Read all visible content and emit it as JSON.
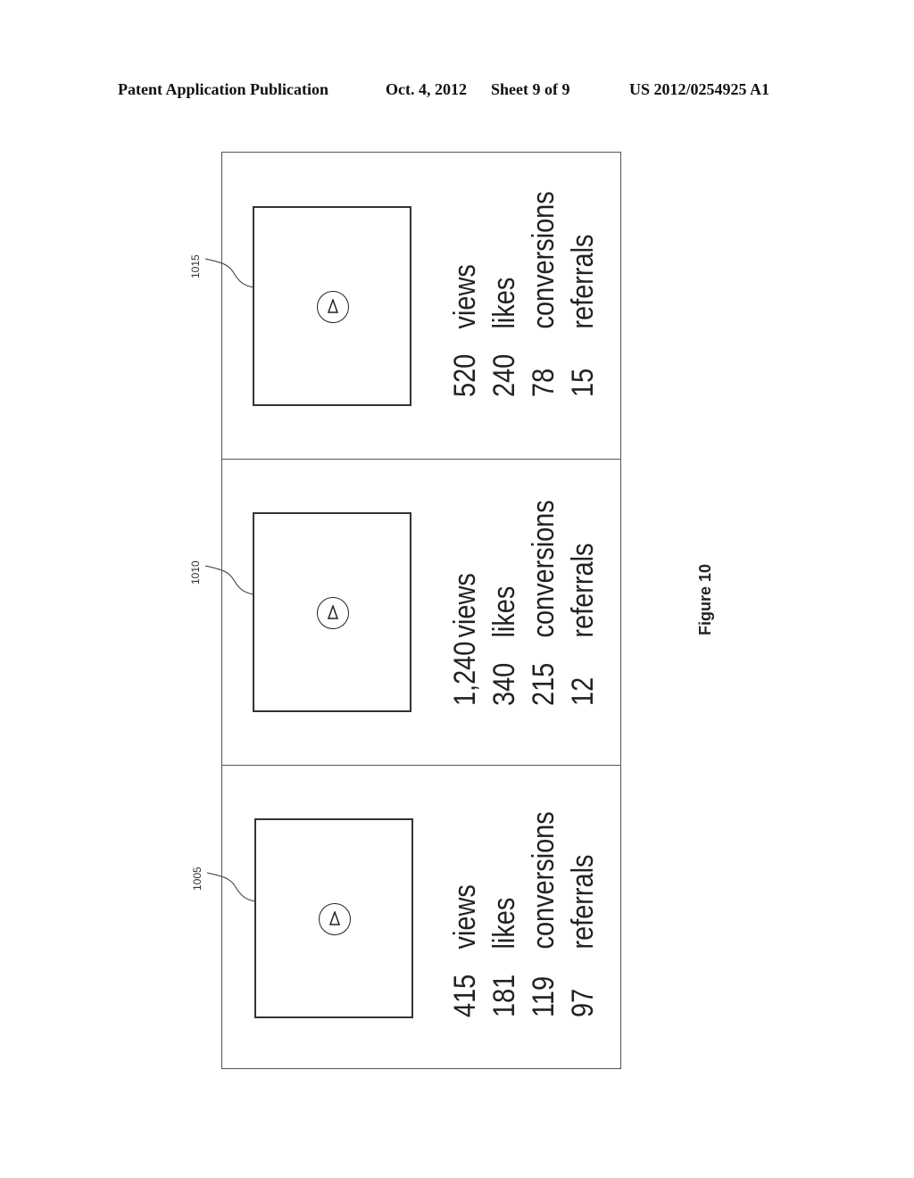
{
  "header": {
    "publication": "Patent Application Publication",
    "date": "Oct. 4, 2012",
    "sheet": "Sheet 9 of 9",
    "patent_number": "US 2012/0254925 A1"
  },
  "figure": {
    "label": "Figure 10",
    "panels": [
      {
        "ref": "1015",
        "icon": "play-icon",
        "stats": [
          {
            "value": "520",
            "label": "views"
          },
          {
            "value": "240",
            "label": "likes"
          },
          {
            "value": "78",
            "label": "conversions"
          },
          {
            "value": "15",
            "label": "referrals"
          }
        ]
      },
      {
        "ref": "1010",
        "icon": "play-icon",
        "stats": [
          {
            "value": "1,240",
            "label": "views"
          },
          {
            "value": "340",
            "label": "likes"
          },
          {
            "value": "215",
            "label": "conversions"
          },
          {
            "value": "12",
            "label": "referrals"
          }
        ]
      },
      {
        "ref": "1005",
        "icon": "play-icon",
        "stats": [
          {
            "value": "415",
            "label": "views"
          },
          {
            "value": "181",
            "label": "likes"
          },
          {
            "value": "119",
            "label": "conversions"
          },
          {
            "value": "97",
            "label": "referrals"
          }
        ]
      }
    ]
  }
}
